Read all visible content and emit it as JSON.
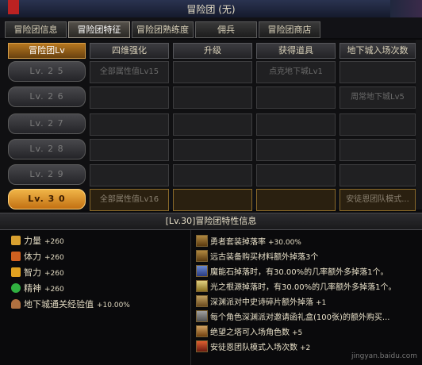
{
  "window": {
    "title": "冒险团 (无)"
  },
  "tabs": [
    "冒险团信息",
    "冒险团特征",
    "冒险团熟练度",
    "佣兵",
    "冒险团商店"
  ],
  "grid": {
    "headers": [
      "冒险团Lv",
      "四维强化",
      "升级",
      "获得道具",
      "地下城入场次数"
    ],
    "rows": [
      {
        "level": "Lv. 2 5",
        "cells": [
          "全部属性值Lv15",
          "",
          "点克地下城Lv1",
          ""
        ]
      },
      {
        "level": "Lv. 2 6",
        "cells": [
          "",
          "",
          "",
          "周常地下城Lv5"
        ]
      },
      {
        "level": "Lv. 2 7",
        "cells": [
          "",
          "",
          "",
          ""
        ]
      },
      {
        "level": "Lv. 2 8",
        "cells": [
          "",
          "",
          "",
          ""
        ]
      },
      {
        "level": "Lv. 2 9",
        "cells": [
          "",
          "",
          "",
          ""
        ]
      },
      {
        "level": "Lv. 3 0",
        "cells": [
          "全部属性值Lv16",
          "",
          "",
          "安徒恩团队模式..."
        ]
      }
    ]
  },
  "info": {
    "title": "[Lv.30]冒险团特性信息"
  },
  "stats": [
    {
      "label": "力量",
      "value": "+260",
      "icon": "strength-icon",
      "color": "#d8a030"
    },
    {
      "label": "体力",
      "value": "+260",
      "icon": "stamina-icon",
      "color": "#d06020"
    },
    {
      "label": "智力",
      "value": "+260",
      "icon": "intelligence-icon",
      "color": "#e0a020"
    },
    {
      "label": "精神",
      "value": "+260",
      "icon": "spirit-icon",
      "color": "#30b040"
    },
    {
      "label": "地下城通关经验值",
      "value": "+10.00%",
      "icon": "exp-icon",
      "color": "#b07040"
    }
  ],
  "perks": [
    {
      "text": "勇者套装掉落率",
      "value": "+30.00%"
    },
    {
      "text": "远古装备购买材料额外掉落3个",
      "value": ""
    },
    {
      "text": "魔能石掉落时，有30.00%的几率额外多掉落1个。",
      "value": ""
    },
    {
      "text": "光之根源掉落时，有30.00%的几率额外多掉落1个。",
      "value": ""
    },
    {
      "text": "深渊派对中史诗碎片额外掉落",
      "value": "+1"
    },
    {
      "text": "每个角色深渊派对邀请函礼盒(100张)的额外购买...",
      "value": ""
    },
    {
      "text": "绝望之塔可入场角色数",
      "value": "+5"
    },
    {
      "text": "安徒恩团队模式入场次数",
      "value": "+2"
    }
  ],
  "watermark": "jingyan.baidu.com"
}
